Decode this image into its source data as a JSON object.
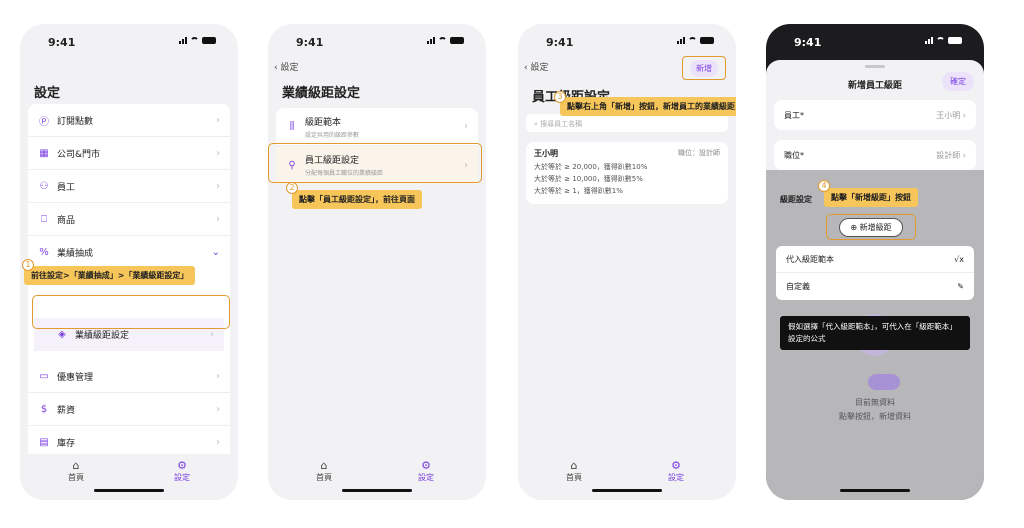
{
  "status": {
    "time": "9:41"
  },
  "tabs": {
    "home": "首頁",
    "settings": "設定"
  },
  "p1": {
    "title": "設定",
    "items": [
      {
        "icon": "Ⓟ",
        "label": "訂閱點數"
      },
      {
        "icon": "▦",
        "label": "公司&門市"
      },
      {
        "icon": "⚇",
        "label": "員工"
      },
      {
        "icon": "⎕",
        "label": "商品"
      },
      {
        "icon": "%",
        "label": "業績抽成"
      }
    ],
    "sub_item": "業績級距設定",
    "items2": [
      {
        "icon": "▭",
        "label": "優惠管理"
      },
      {
        "icon": "$",
        "label": "薪資"
      },
      {
        "icon": "▤",
        "label": "庫存"
      }
    ],
    "callout": "前往設定>「業績抽成」>「業績級距設定」",
    "badge": "1"
  },
  "p2": {
    "back": "設定",
    "title": "業績級距設定",
    "rows": [
      {
        "label": "級距範本",
        "sub": "設定共用的級距參數"
      },
      {
        "label": "員工級距設定",
        "sub": "分配每個員工職位的業績級距"
      }
    ],
    "callout": "點擊「員工級距設定」，前往頁面",
    "badge": "2"
  },
  "p3": {
    "back": "設定",
    "title": "員工級距設定",
    "add": "新增",
    "search_placeholder": "搜尋員工名稱",
    "callout": "點擊右上角「新增」按鈕，新增員工的業績級距",
    "badge": "3",
    "emp": {
      "name": "王小明",
      "role": "職位：設計師",
      "lines": [
        "大於等於 ≥ 20,000，獲得趴數10%",
        "大於等於 ≥ 10,000，獲得趴數5%",
        "大於等於 ≥ 1，獲得趴數1%"
      ]
    }
  },
  "p4": {
    "title": "新增員工級距",
    "confirm": "確定",
    "f1": {
      "label": "員工*",
      "value": "王小明"
    },
    "f2": {
      "label": "職位*",
      "value": "設計師"
    },
    "section": "級距設定",
    "add_btn": "⊕ 新增級距",
    "menu": [
      {
        "label": "代入級距範本",
        "icon": "√x"
      },
      {
        "label": "自定義",
        "icon": "✎"
      }
    ],
    "tooltip": "假如選擇「代入級距範本」，可代入在「級距範本」設定的公式",
    "callout": "點擊「新增級距」按鈕",
    "badge": "4",
    "empty1": "目前無資料",
    "empty2": "點擊按鈕，新增資料"
  }
}
